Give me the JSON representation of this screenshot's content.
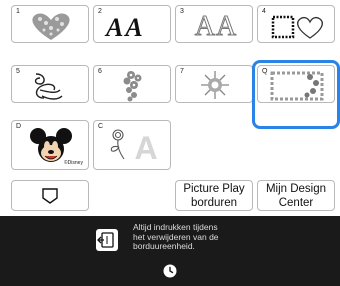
{
  "tiles": [
    {
      "num": "1",
      "icon": "heart-floral-pattern"
    },
    {
      "num": "2",
      "icon": "letter-a-fonts",
      "text": "AA"
    },
    {
      "num": "3",
      "icon": "outline-letters",
      "text": "AA"
    },
    {
      "num": "4",
      "icon": "frame-and-heart"
    },
    {
      "num": "5",
      "icon": "swirl-ornament"
    },
    {
      "num": "6",
      "icon": "floral-motif"
    },
    {
      "num": "7",
      "icon": "sun-motif"
    },
    {
      "num": "Q",
      "icon": "quilt-border-pattern",
      "selected": true
    },
    {
      "num": "D",
      "icon": "mickey-mouse",
      "caption": "©Disney"
    },
    {
      "num": "C",
      "icon": "rose-letter-a",
      "text": "A"
    }
  ],
  "buttons": {
    "pocket_icon": "pocket-shape-icon",
    "picture_play": [
      "Picture Play",
      "borduren"
    ],
    "my_design": [
      "Mijn Design",
      "Center"
    ]
  },
  "message": {
    "icon": "embroidery-unit-icon",
    "lines": [
      "Altijd indrukken tijdens",
      "het verwijderen van de",
      "borduureenheid."
    ]
  },
  "footer": {
    "icon": "clock-icon"
  },
  "colors": {
    "selection": "#2a83e6",
    "bar": "#1a1a1a"
  }
}
